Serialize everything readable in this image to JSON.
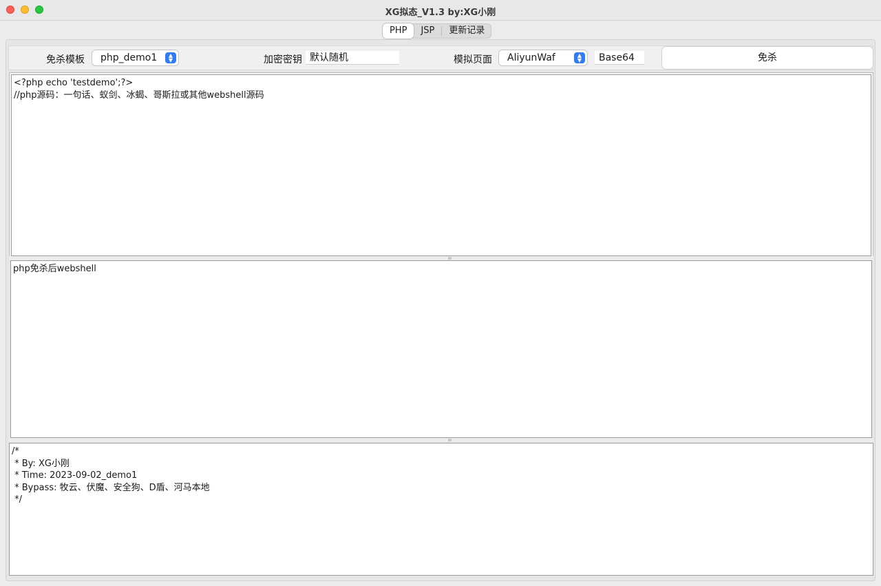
{
  "window": {
    "title": "XG拟态_V1.3  by:XG小刚"
  },
  "tabs": [
    {
      "label": "PHP",
      "active": true
    },
    {
      "label": "JSP",
      "active": false
    },
    {
      "label": "更新记录",
      "active": false
    }
  ],
  "toolbar": {
    "template_label": "免杀模板",
    "template_value": "php_demo1",
    "key_label": "加密密钥",
    "key_value": "默认随机",
    "page_label": "模拟页面",
    "page_value": "AliyunWaf",
    "encoding_value": "Base64",
    "run_label": "免杀"
  },
  "editors": {
    "source": "<?php echo 'testdemo';?>\n//php源码：一句话、蚁剑、冰蝎、哥斯拉或其他webshell源码",
    "output": "php免杀后webshell",
    "log": "/*\n * By: XG小刚\n * Time: 2023-09-02_demo1\n * Bypass: 牧云、伏魔、安全狗、D盾、河马本地\n */"
  },
  "icons": {
    "stepper": "updown-chevron-icon"
  },
  "colors": {
    "accent": "#2f7cf6",
    "close": "#ff5f57",
    "minimize": "#febc2e",
    "maximize": "#28c840"
  }
}
